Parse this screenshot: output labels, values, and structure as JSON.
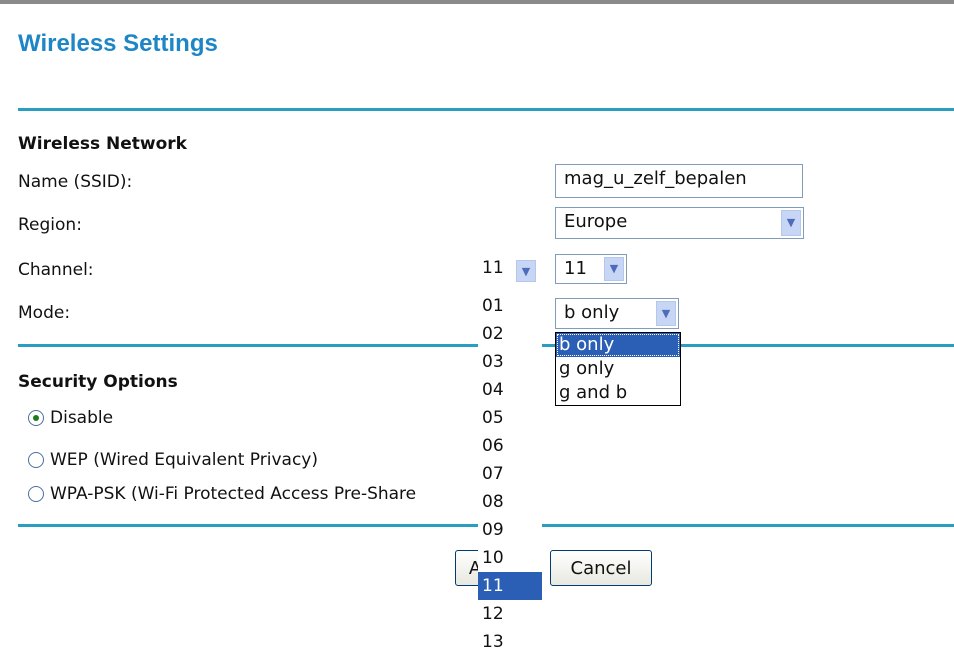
{
  "page": {
    "title": "Wireless Settings"
  },
  "wireless_network": {
    "heading": "Wireless Network",
    "ssid_label": "Name (SSID):",
    "ssid_value": "mag_u_zelf_bepalen",
    "region_label": "Region:",
    "region_value": "Europe",
    "channel_label": "Channel:",
    "channel_value": "11",
    "channel_open_value": "11",
    "channel_options": [
      "01",
      "02",
      "03",
      "04",
      "05",
      "06",
      "07",
      "08",
      "09",
      "10",
      "11",
      "12",
      "13"
    ],
    "mode_label": "Mode:",
    "mode_value": "b only",
    "mode_options": [
      "b only",
      "g only",
      "g and b"
    ]
  },
  "security": {
    "heading": "Security Options",
    "options": [
      "Disable",
      "WEP (Wired Equivalent Privacy)",
      "WPA-PSK (Wi-Fi Protected Access Pre-Share"
    ],
    "selected": "Disable"
  },
  "buttons": {
    "apply_label": "A",
    "cancel_label": "Cancel"
  }
}
